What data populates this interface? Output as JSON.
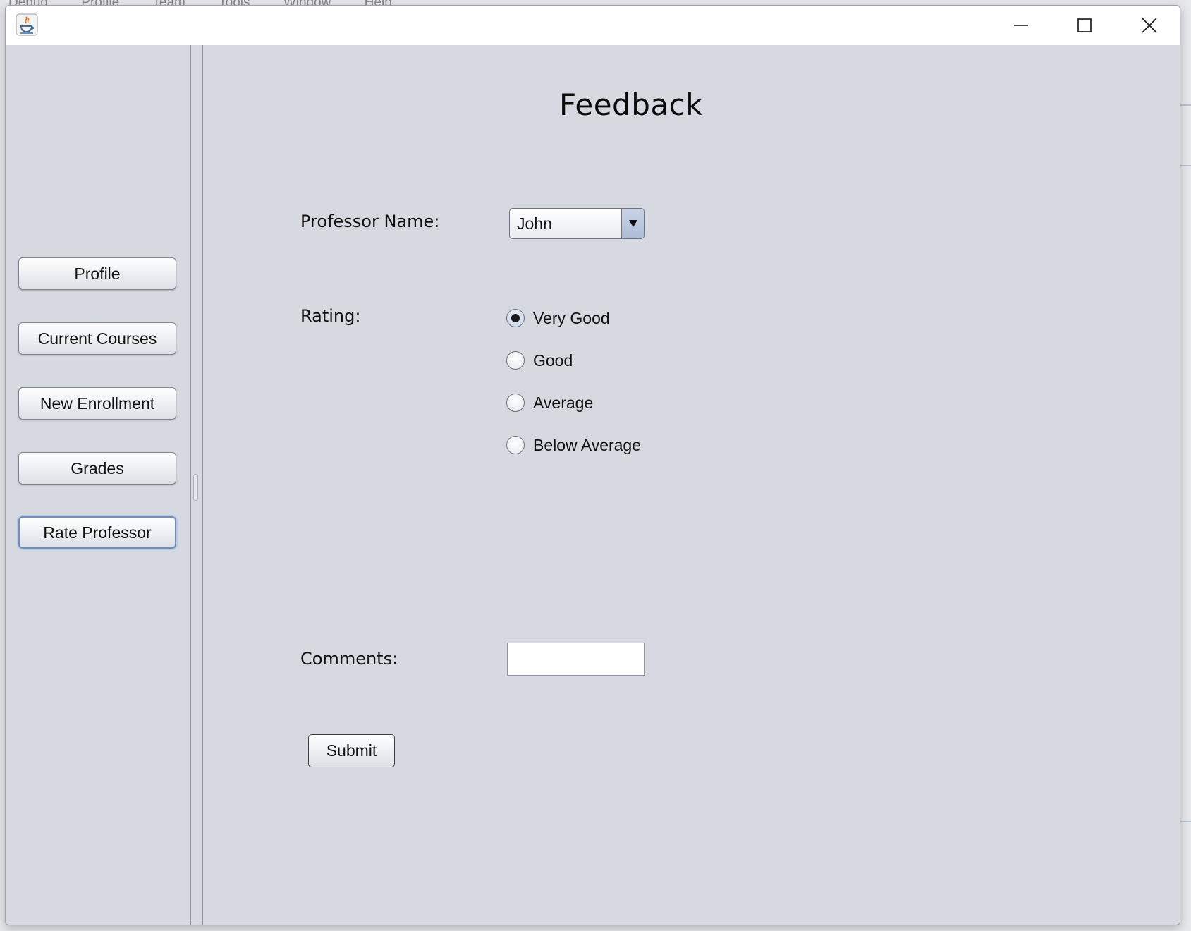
{
  "window": {
    "backdrop_menu": [
      "Debug",
      "Profile",
      "Team",
      "Tools",
      "Window",
      "Help"
    ]
  },
  "sidebar": {
    "items": [
      {
        "label": "Profile"
      },
      {
        "label": "Current Courses"
      },
      {
        "label": "New Enrollment"
      },
      {
        "label": "Grades"
      },
      {
        "label": "Rate Professor",
        "focused": true
      }
    ]
  },
  "main": {
    "title": "Feedback",
    "professor_label": "Professor Name:",
    "professor_selected": "John",
    "rating_label": "Rating:",
    "rating_options": [
      {
        "label": "Very Good",
        "checked": true
      },
      {
        "label": "Good",
        "checked": false
      },
      {
        "label": "Average",
        "checked": false
      },
      {
        "label": "Below Average",
        "checked": false
      }
    ],
    "comments_label": "Comments:",
    "comments_value": "",
    "submit_label": "Submit"
  },
  "icons": {
    "app": "java-icon",
    "minimize": "minimize-icon",
    "maximize": "maximize-icon",
    "close": "close-icon",
    "dropdown": "chevron-down-icon"
  },
  "colors": {
    "panel_bg": "#d7d9e0",
    "titlebar_bg": "#ffffff",
    "focus_ring": "#6f8fb8"
  }
}
